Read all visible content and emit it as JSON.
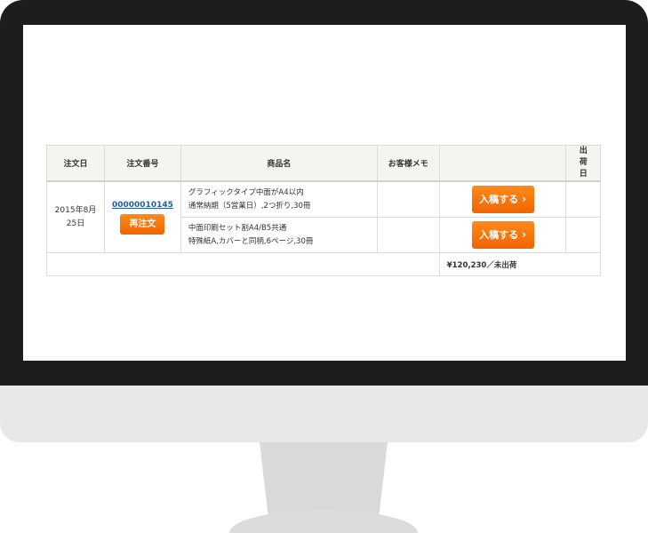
{
  "table": {
    "headers": {
      "order_date": "注文日",
      "order_number": "注文番号",
      "product_name": "商品名",
      "customer_memo": "お客様メモ",
      "action": "",
      "ship_date": "出荷日"
    },
    "order": {
      "date": "2015年8月25日",
      "number": "00000010145",
      "reorder_label": "再注文",
      "items": [
        {
          "name_line1": "グラフィックタイプ中面がA4以内",
          "name_line2": "通常納期（5営業日）,2つ折り,30冊",
          "memo": "",
          "submit_label": "入稿する",
          "ship_date": ""
        },
        {
          "name_line1": "中面印刷セット割A4/B5共通",
          "name_line2": "特殊紙A,カバーと同柄,6ページ,30冊",
          "memo": "",
          "submit_label": "入稿する",
          "ship_date": ""
        }
      ]
    },
    "total": "¥120,230／未出荷"
  },
  "icons": {
    "submit_chevron": "chevron-right-icon"
  }
}
